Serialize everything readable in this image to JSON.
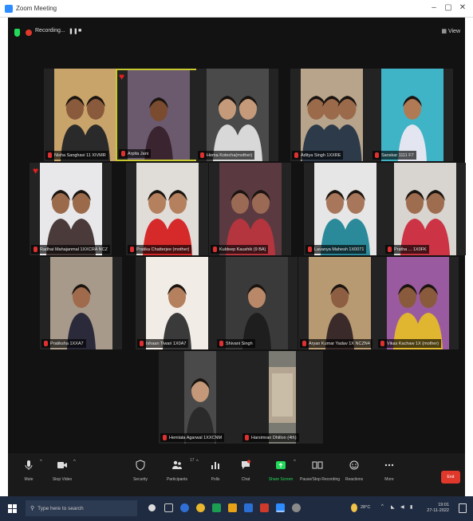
{
  "window": {
    "title": "Zoom Meeting",
    "controls": [
      "–",
      "▢",
      "✕"
    ]
  },
  "recording": {
    "label": "Recording...",
    "pause": "❚❚",
    "stop": "■"
  },
  "view_button": "▦ View",
  "participants": [
    {
      "name": "Nisha Sanghavi 11 XIVMR"
    },
    {
      "name": "Arpita Jani"
    },
    {
      "name": "Hema Kotecha(mother)"
    },
    {
      "name": "Aditya Singh 1XXRE"
    },
    {
      "name": "Sanskar 1111 F7"
    },
    {
      "name": "Radhai Mahajanmal 1XXCRA NCZ"
    },
    {
      "name": "Pratika Chatterjee (mother)"
    },
    {
      "name": "Kuldeep Kaushik (9 BA)"
    },
    {
      "name": "Lavanya Mahesh 1X0071"
    },
    {
      "name": "Pratha ... 1X0FK"
    },
    {
      "name": "Pratiksha 1XXA7"
    },
    {
      "name": "Ishaan Tiwari 1X0A7"
    },
    {
      "name": "Shivani Singh"
    },
    {
      "name": "Aryan Kumar Yadav 1X NCZN4"
    },
    {
      "name": "Vikas Kachaw 1X (mother)"
    },
    {
      "name": "Hemlata Agarwal 1XXCNM"
    },
    {
      "name": "Harsimran Dhillon (4th)"
    }
  ],
  "toolbar": {
    "items": [
      {
        "label": "Mute",
        "icon": "microphone-icon"
      },
      {
        "label": "Stop Video",
        "icon": "camera-icon"
      },
      {
        "label": "Security",
        "icon": "shield-icon"
      },
      {
        "label": "Participants",
        "icon": "participants-icon",
        "count": "17"
      },
      {
        "label": "Polls",
        "icon": "polls-icon"
      },
      {
        "label": "Chat",
        "icon": "chat-icon"
      },
      {
        "label": "Share Screen",
        "icon": "share-screen-icon"
      },
      {
        "label": "Pause/Stop Recording",
        "icon": "record-icon"
      },
      {
        "label": "Reactions",
        "icon": "reactions-icon"
      },
      {
        "label": "More",
        "icon": "more-icon"
      }
    ],
    "end": "End",
    "accent": "#23d959",
    "end_color": "#e0392b"
  },
  "taskbar": {
    "search_placeholder": "Type here to search",
    "temp": "28°C",
    "time": "19:01",
    "date": "27-11-2022"
  }
}
